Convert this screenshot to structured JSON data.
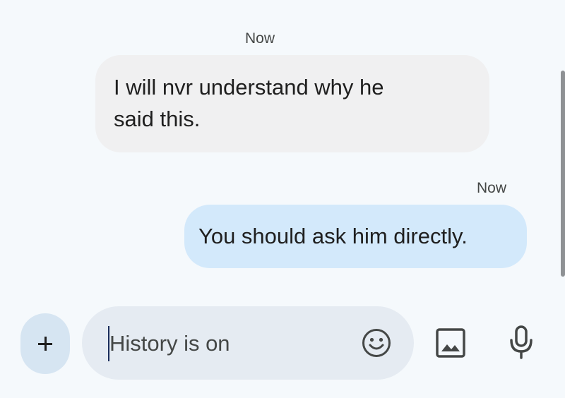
{
  "conversation": {
    "messages": [
      {
        "direction": "incoming",
        "timestamp": "Now",
        "lines": [
          "I will nvr understand why he",
          "said this."
        ]
      },
      {
        "direction": "outgoing",
        "timestamp": "Now",
        "text": "You should ask him directly."
      }
    ]
  },
  "compose": {
    "add_label": "+",
    "placeholder": "History is on",
    "icons": {
      "add": "plus-icon",
      "emoji": "emoji-icon",
      "gallery": "image-icon",
      "voice": "microphone-icon"
    }
  },
  "colors": {
    "background": "#f5f9fc",
    "incoming_bubble": "#f0f0f1",
    "outgoing_bubble": "#d3e9fb",
    "compose_field": "#e5ebf2",
    "add_button": "#d6e5f2",
    "icon": "#444746"
  }
}
